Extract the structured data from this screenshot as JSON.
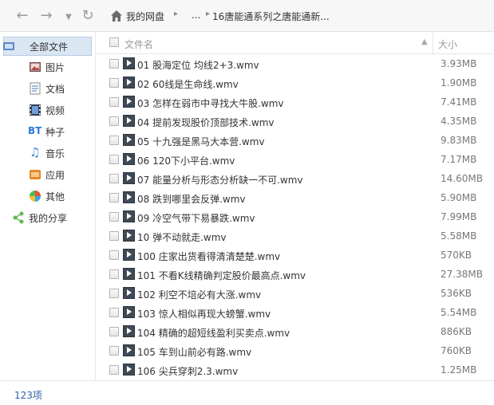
{
  "nav": {
    "breadcrumb": [
      "我的网盘",
      "...",
      "16唐能通系列之唐能通新..."
    ]
  },
  "sidebar": {
    "items": [
      {
        "label": "全部文件",
        "icon": "all-files-icon",
        "active": true
      },
      {
        "label": "图片",
        "icon": "image-icon"
      },
      {
        "label": "文档",
        "icon": "document-icon"
      },
      {
        "label": "视频",
        "icon": "video-icon"
      },
      {
        "label": "种子",
        "icon": "bt-torrent-icon"
      },
      {
        "label": "音乐",
        "icon": "music-icon"
      },
      {
        "label": "应用",
        "icon": "app-icon"
      },
      {
        "label": "其他",
        "icon": "other-icon"
      },
      {
        "label": "我的分享",
        "icon": "share-icon"
      }
    ]
  },
  "columns": {
    "name": "文件名",
    "size": "大小"
  },
  "files": [
    {
      "name": "01 股海定位 均线2+3.wmv",
      "size": "3.93MB"
    },
    {
      "name": "02 60线是生命线.wmv",
      "size": "1.90MB"
    },
    {
      "name": "03 怎样在弱市中寻找大牛股.wmv",
      "size": "7.41MB"
    },
    {
      "name": "04 提前发现股价顶部技术.wmv",
      "size": "4.35MB"
    },
    {
      "name": "05 十九强是黑马大本营.wmv",
      "size": "9.83MB"
    },
    {
      "name": "06 120下小平台.wmv",
      "size": "7.17MB"
    },
    {
      "name": "07 能量分析与形态分析缺一不可.wmv",
      "size": "14.60MB"
    },
    {
      "name": "08 跌到哪里会反弹.wmv",
      "size": "5.90MB"
    },
    {
      "name": "09 冷空气带下易暴跌.wmv",
      "size": "7.99MB"
    },
    {
      "name": "10 弹不动就走.wmv",
      "size": "5.58MB"
    },
    {
      "name": "100 庄家出货看得清清楚楚.wmv",
      "size": "570KB"
    },
    {
      "name": "101 不看K线精确判定股价最高点.wmv",
      "size": "27.38MB"
    },
    {
      "name": "102 利空不培必有大涨.wmv",
      "size": "536KB"
    },
    {
      "name": "103 惊人相似再现大螃蟹.wmv",
      "size": "5.54MB"
    },
    {
      "name": "104 精确的超短线盈利买卖点.wmv",
      "size": "886KB"
    },
    {
      "name": "105 车到山前必有路.wmv",
      "size": "760KB"
    },
    {
      "name": "106 尖兵穿刺2.3.wmv",
      "size": "1.25MB"
    }
  ],
  "status": {
    "count": "123项"
  }
}
